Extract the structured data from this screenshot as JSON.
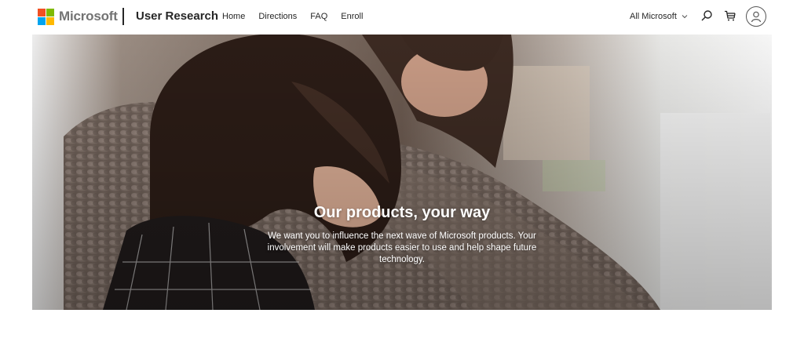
{
  "header": {
    "brand_name": "Microsoft",
    "brand_colors": [
      "#f25022",
      "#7fba00",
      "#00a4ef",
      "#ffb900"
    ],
    "site_title": "User Research",
    "nav": [
      {
        "label": "Home"
      },
      {
        "label": "Directions"
      },
      {
        "label": "FAQ"
      },
      {
        "label": "Enroll"
      }
    ],
    "all_microsoft_label": "All Microsoft",
    "icons": [
      "chevron-down-icon",
      "search-icon",
      "cart-icon",
      "account-icon"
    ]
  },
  "hero": {
    "heading": "Our products, your way",
    "body": "We want you to influence the next wave of Microsoft products. Your involvement will make products easier to use and help shape future technology.",
    "image_subject": "two people looking down at a device, one in a knit sweater"
  }
}
